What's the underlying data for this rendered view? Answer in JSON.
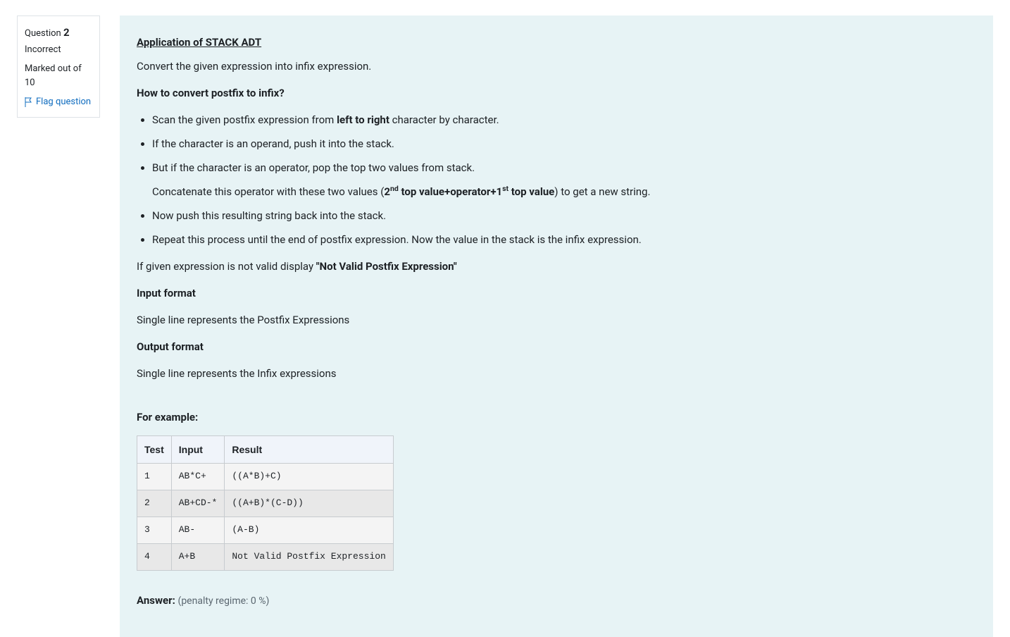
{
  "info": {
    "question_label": "Question",
    "question_number": "2",
    "status": "Incorrect",
    "marked_label": "Marked out of",
    "marked_value": "10",
    "flag_label": "Flag question"
  },
  "body": {
    "title": "Application of STACK ADT",
    "intro": "Convert the given expression into infix expression.",
    "how_heading": "How to convert postfix to infix?",
    "steps": {
      "s1_a": "Scan the given postfix expression from ",
      "s1_b": "left to right",
      "s1_c": " character by character.",
      "s2": "If the character is an operand, push it into the stack.",
      "s3": "But if the character is an operator, pop the top two values from stack.",
      "s3_sub_a": "Concatenate this operator with these two values (",
      "s3_sub_b_pre": "2",
      "s3_sub_b_sup": "nd",
      "s3_sub_b_mid": " top value+operator+1",
      "s3_sub_b_sup2": "st",
      "s3_sub_b_post": " top value",
      "s3_sub_c": ") to get a new string.",
      "s4": "Now push this resulting string back into the stack.",
      "s5": "Repeat this process until the end of postfix expression. Now the value in the stack is the infix expression."
    },
    "invalid_a": "If given expression is not valid display ",
    "invalid_b": "\"Not Valid Postfix Expression\"",
    "input_format_h": "Input format",
    "input_format_t": "Single line represents the Postfix Expressions",
    "output_format_h": "Output format",
    "output_format_t": "Single line represents the Infix expressions",
    "example_h": "For example:",
    "table": {
      "headers": {
        "c1": "Test",
        "c2": "Input",
        "c3": "Result"
      },
      "rows": [
        {
          "test": "1",
          "input": "AB*C+",
          "result": "((A*B)+C)"
        },
        {
          "test": "2",
          "input": "AB+CD-*",
          "result": "((A+B)*(C-D))"
        },
        {
          "test": "3",
          "input": "AB-",
          "result": "(A-B)"
        },
        {
          "test": "4",
          "input": "A+B",
          "result": "Not Valid Postfix Expression"
        }
      ]
    },
    "answer_label": "Answer:",
    "penalty": "(penalty regime: 0 %)"
  }
}
